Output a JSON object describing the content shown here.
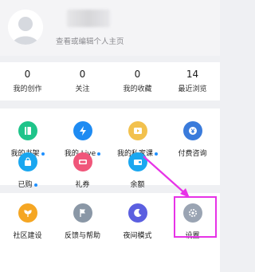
{
  "profile": {
    "hint": "查看或编辑个人主页"
  },
  "stats": [
    {
      "value": "0",
      "label": "我的创作"
    },
    {
      "value": "0",
      "label": "关注"
    },
    {
      "value": "0",
      "label": "我的收藏"
    },
    {
      "value": "14",
      "label": "最近浏览"
    }
  ],
  "grid1": [
    {
      "label": "我的书架",
      "icon": "bookshelf-icon",
      "color": "#1fc48a",
      "dot": true
    },
    {
      "label": "我的 Live",
      "icon": "lightning-icon",
      "color": "#1e8bf2",
      "dot": true
    },
    {
      "label": "我的私家课",
      "icon": "video-course-icon",
      "color": "#f2c14e",
      "dot": true
    },
    {
      "label": "付费咨询",
      "icon": "yen-consult-icon",
      "color": "#3a7bdb",
      "dot": false
    },
    {
      "label": "已购",
      "icon": "purchased-bag-icon",
      "color": "#1aa7f0",
      "dot": true
    },
    {
      "label": "礼券",
      "icon": "coupon-icon",
      "color": "#f0567a",
      "dot": false
    },
    {
      "label": "余额",
      "icon": "wallet-icon",
      "color": "#1aa7f0",
      "dot": false
    }
  ],
  "grid2": [
    {
      "label": "社区建设",
      "icon": "sprout-icon",
      "color": "#f5a623"
    },
    {
      "label": "反馈与帮助",
      "icon": "flag-icon",
      "color": "#8a97a6"
    },
    {
      "label": "夜间模式",
      "icon": "moon-icon",
      "color": "#5b5fe0"
    },
    {
      "label": "设置",
      "icon": "settings-gear-icon",
      "color": "#9aa4b3"
    }
  ],
  "colors": {
    "highlight": "#e733e7",
    "dot": "#1e90ff"
  }
}
